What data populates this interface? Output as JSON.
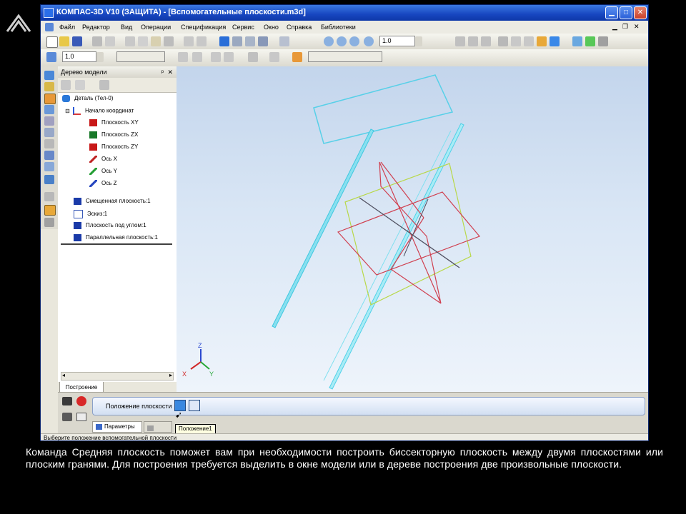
{
  "window": {
    "title": "КОМПАС-3D V10 (ЗАЩИТА) - [Вспомогательные плоскости.m3d]"
  },
  "menu": [
    "Файл",
    "Редактор",
    "Вид",
    "Операции",
    "Спецификация",
    "Сервис",
    "Окно",
    "Справка",
    "Библиотеки"
  ],
  "toolbar": {
    "zoom_value": "1.0",
    "line_width": "1.0"
  },
  "tree": {
    "header": "Дерево модели",
    "root": "Деталь (Тел-0)",
    "origin": "Начало координат",
    "items": [
      "Плоскость XY",
      "Плоскость ZX",
      "Плоскость ZY",
      "Ось X",
      "Ось Y",
      "Ось Z",
      "Смещенная плоскость:1",
      "Эскиз:1",
      "Плоскость под углом:1",
      "Параллельная плоскость:1"
    ],
    "tab": "Построение"
  },
  "axes": {
    "x": "X",
    "y": "Y",
    "z": "Z"
  },
  "properties": {
    "position_label": "Положение плоскости",
    "tooltip": "Положение1",
    "tab_params": "Параметры"
  },
  "status": {
    "text": "Выберите положение вспомогательной плоскости"
  },
  "caption": "Команда Средняя плоскость поможет вам при необходимости построить биссекторную плоскость между двумя плоскостями или плоским гранями. Для построения требуется выделить в окне модели или в дереве построения две произвольные плоскости.",
  "colors": {
    "title_bar": "#1746c0",
    "viewport_top": "#c3d5ec",
    "plane_red": "#d04050",
    "plane_yellowgreen": "#b8d848",
    "plane_cyan": "#5ad8ec"
  }
}
